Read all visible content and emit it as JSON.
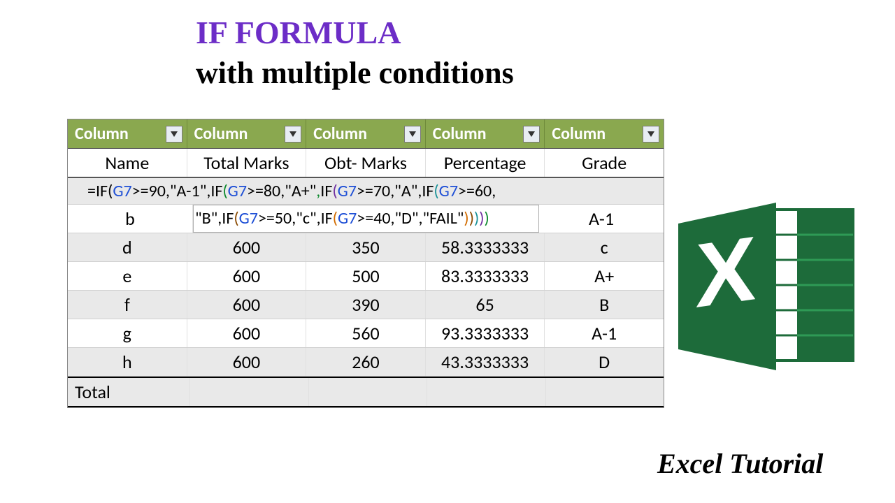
{
  "title": {
    "line1": "IF FORMULA",
    "line2": "with multiple conditions"
  },
  "table": {
    "filter_headers": [
      "Column",
      "Column",
      "Column",
      "Column",
      "Column"
    ],
    "sub_headers": [
      "Name",
      "Total Marks",
      "Obt- Marks",
      "Percentage",
      "Grade"
    ],
    "formula_line1_tokens": [
      {
        "t": "=",
        "c": "f-black"
      },
      {
        "t": "IF",
        "c": "f-black"
      },
      {
        "t": "(",
        "c": "f-black"
      },
      {
        "t": "G7",
        "c": "f-blue"
      },
      {
        "t": ">=90,\"A-1\",",
        "c": "f-black"
      },
      {
        "t": "IF",
        "c": "f-black"
      },
      {
        "t": "(",
        "c": "f-green"
      },
      {
        "t": "G7",
        "c": "f-blue"
      },
      {
        "t": ">=80,\"A+\"",
        "c": "f-black"
      },
      {
        "t": ",",
        "c": "f-green"
      },
      {
        "t": "IF",
        "c": "f-black"
      },
      {
        "t": "(",
        "c": "f-purple"
      },
      {
        "t": "G7",
        "c": "f-blue"
      },
      {
        "t": ">=70,\"A\",",
        "c": "f-black"
      },
      {
        "t": "IF",
        "c": "f-black"
      },
      {
        "t": "(",
        "c": "f-teal"
      },
      {
        "t": "G7",
        "c": "f-blue"
      },
      {
        "t": ">=60,",
        "c": "f-black"
      }
    ],
    "row_b_name": "b",
    "formula_line2_tokens": [
      {
        "t": "\"B\",",
        "c": "f-black"
      },
      {
        "t": "IF",
        "c": "f-black"
      },
      {
        "t": "(",
        "c": "f-brown"
      },
      {
        "t": "G7",
        "c": "f-blue"
      },
      {
        "t": ">=50,\"c\",",
        "c": "f-black"
      },
      {
        "t": "IF",
        "c": "f-black"
      },
      {
        "t": "(",
        "c": "f-orange"
      },
      {
        "t": "G7",
        "c": "f-blue"
      },
      {
        "t": ">=40,\"D\",\"FAIL\"",
        "c": "f-black"
      },
      {
        "t": ")",
        "c": "f-orange"
      },
      {
        "t": ")",
        "c": "f-brown"
      },
      {
        "t": ")",
        "c": "f-teal"
      },
      {
        "t": ")",
        "c": "f-purple"
      },
      {
        "t": ")",
        "c": "f-green"
      }
    ],
    "row_b_grade": "A-1",
    "rows": [
      {
        "name": "d",
        "total": "600",
        "obt": "350",
        "pct": "58.3333333",
        "grade": "c",
        "band": "band"
      },
      {
        "name": "e",
        "total": "600",
        "obt": "500",
        "pct": "83.3333333",
        "grade": "A+",
        "band": "alt"
      },
      {
        "name": "f",
        "total": "600",
        "obt": "390",
        "pct": "65",
        "grade": "B",
        "band": "band"
      },
      {
        "name": "g",
        "total": "600",
        "obt": "560",
        "pct": "93.3333333",
        "grade": "A-1",
        "band": "alt"
      },
      {
        "name": "h",
        "total": "600",
        "obt": "260",
        "pct": "43.3333333",
        "grade": "D",
        "band": "band"
      }
    ],
    "total_label": "Total"
  },
  "footer": "Excel Tutorial",
  "chart_data": {
    "type": "table",
    "title": "IF FORMULA with multiple conditions",
    "columns": [
      "Name",
      "Total Marks",
      "Obt- Marks",
      "Percentage",
      "Grade"
    ],
    "rows": [
      [
        "b",
        null,
        null,
        null,
        "A-1"
      ],
      [
        "d",
        600,
        350,
        58.3333333,
        "c"
      ],
      [
        "e",
        600,
        500,
        83.3333333,
        "A+"
      ],
      [
        "f",
        600,
        390,
        65,
        "B"
      ],
      [
        "g",
        600,
        560,
        93.3333333,
        "A-1"
      ],
      [
        "h",
        600,
        260,
        43.3333333,
        "D"
      ]
    ],
    "formula": "=IF(G7>=90,\"A-1\",IF(G7>=80,\"A+\",IF(G7>=70,\"A\",IF(G7>=60,\"B\",IF(G7>=50,\"c\",IF(G7>=40,\"D\",\"FAIL\"))))))"
  }
}
